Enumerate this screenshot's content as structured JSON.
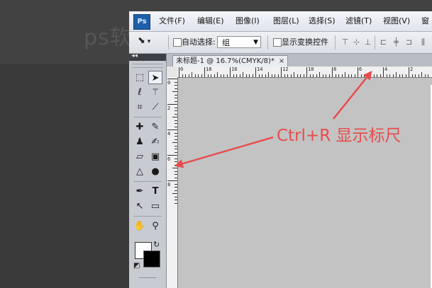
{
  "watermark": "ps软",
  "menubar": {
    "logo": "Ps",
    "items": [
      {
        "label": "文件(F)"
      },
      {
        "label": "编辑(E)"
      },
      {
        "label": "图像(I)"
      },
      {
        "label": "图层(L)"
      },
      {
        "label": "选择(S)"
      },
      {
        "label": "滤镜(T)"
      },
      {
        "label": "视图(V)"
      },
      {
        "label": "窗"
      }
    ]
  },
  "options": {
    "tool_icon": "move-tool-icon",
    "auto_select_label": "自动选择:",
    "auto_select_value": "组",
    "show_transform_label": "显示变换控件"
  },
  "document": {
    "tab_title": "未标题-1 @ 16.7%(CMYK/8)*",
    "close_glyph": "×"
  },
  "rulers": {
    "top": [
      "0",
      "18",
      "16",
      "14",
      "12",
      "10",
      "8",
      "6",
      "4",
      "2"
    ],
    "left": [
      "0",
      "2",
      "4",
      "6",
      "8"
    ]
  },
  "annotation": {
    "text": "Ctrl+R 显示标尺",
    "color": "#e84c4c"
  },
  "colors": {
    "foreground": "#ffffff",
    "background": "#000000"
  }
}
